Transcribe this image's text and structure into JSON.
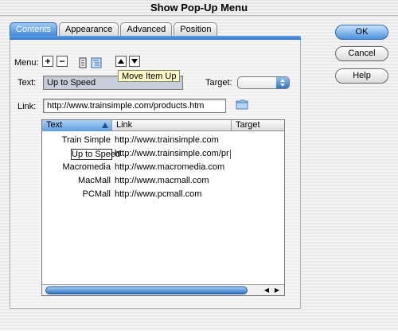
{
  "window": {
    "title": "Show Pop-Up Menu"
  },
  "tabs": [
    {
      "label": "Contents",
      "active": true
    },
    {
      "label": "Appearance",
      "active": false
    },
    {
      "label": "Advanced",
      "active": false
    },
    {
      "label": "Position",
      "active": false
    }
  ],
  "toolbar": {
    "menu_label": "Menu:",
    "add_label": "+",
    "remove_label": "−",
    "tooltip": "Move Item Up"
  },
  "form": {
    "text_label": "Text:",
    "text_value": "Up to Speed",
    "target_label": "Target:",
    "target_value": "",
    "link_label": "Link:",
    "link_value": "http://www.trainsimple.com/products.htm"
  },
  "table": {
    "columns": [
      "Text",
      "Link",
      "Target"
    ],
    "rows": [
      {
        "text": "Train Simple",
        "link": "http://www.trainsimple.com",
        "target": ""
      },
      {
        "text": "Up to Speed",
        "link": "http://www.trainsimple.com/pr",
        "target": ""
      },
      {
        "text": "Macromedia",
        "link": "http://www.macromedia.com",
        "target": ""
      },
      {
        "text": "MacMall",
        "link": "http://www.macmall.com",
        "target": ""
      },
      {
        "text": "PCMall",
        "link": "http://www.pcmall.com",
        "target": ""
      }
    ]
  },
  "buttons": {
    "ok": "OK",
    "cancel": "Cancel",
    "help": "Help"
  },
  "colors": {
    "accent": "#3f87d6",
    "tooltip_bg": "#ffffc8"
  }
}
